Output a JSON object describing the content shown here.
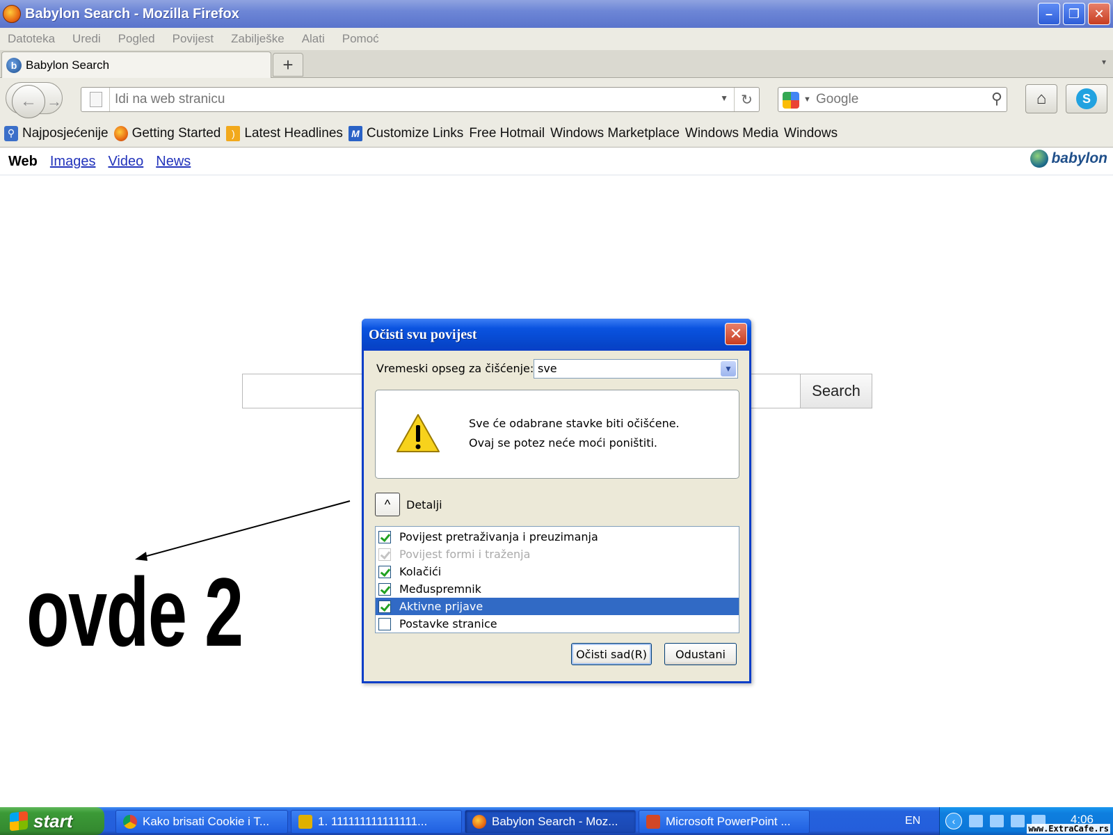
{
  "window": {
    "title": "Babylon Search - Mozilla Firefox",
    "minimize": "–",
    "maximize": "❐",
    "close": "✕"
  },
  "menu": [
    "Datoteka",
    "Uredi",
    "Pogled",
    "Povijest",
    "Zabilješke",
    "Alati",
    "Pomoć"
  ],
  "tab": {
    "label": "Babylon Search",
    "new_tab": "+",
    "list": "▾"
  },
  "nav": {
    "back": "←",
    "forward": "→",
    "url_placeholder": "Idi na web stranicu",
    "reload": "↻",
    "search_placeholder": "Google",
    "search_icon": "search-icon",
    "home": "⌂",
    "skype": "S"
  },
  "bookmarks": [
    {
      "label": "Najposjećenije",
      "icon": "most-visited-icon"
    },
    {
      "label": "Getting Started",
      "icon": "firefox-icon"
    },
    {
      "label": "Latest Headlines",
      "icon": "rss-icon"
    },
    {
      "label": "Customize Links",
      "icon": "msn-icon"
    },
    {
      "label": "Free Hotmail",
      "icon": "page-icon"
    },
    {
      "label": "Windows Marketplace",
      "icon": "page-icon"
    },
    {
      "label": "Windows Media",
      "icon": "page-icon"
    },
    {
      "label": "Windows",
      "icon": "page-icon"
    }
  ],
  "babylon": {
    "nav_active": "Web",
    "nav_links": [
      "Images",
      "Video",
      "News"
    ],
    "logo": "babylon",
    "search_button": "Search"
  },
  "annotation": {
    "text": "ovde 2"
  },
  "dialog": {
    "title": "Očisti svu povijest",
    "close": "✕",
    "range_label": "Vremeski opseg za čišćenje:",
    "range_value": "sve",
    "warning_line1": "Sve će odabrane stavke biti očišćene.",
    "warning_line2": "Ovaj se potez neće moći poništiti.",
    "details_toggle": "^",
    "details_label": "Detalji",
    "items": [
      {
        "label": "Povijest pretraživanja i preuzimanja",
        "checked": true,
        "disabled": false,
        "selected": false
      },
      {
        "label": "Povijest formi i traženja",
        "checked": true,
        "disabled": true,
        "selected": false
      },
      {
        "label": "Kolačići",
        "checked": true,
        "disabled": false,
        "selected": false
      },
      {
        "label": "Međuspremnik",
        "checked": true,
        "disabled": false,
        "selected": false
      },
      {
        "label": "Aktivne prijave",
        "checked": true,
        "disabled": false,
        "selected": true
      },
      {
        "label": "Postavke stranice",
        "checked": false,
        "disabled": false,
        "selected": false
      }
    ],
    "ok_button": "Očisti sad(R)",
    "cancel_button": "Odustani"
  },
  "taskbar": {
    "start": "start",
    "buttons": [
      {
        "label": "Kako brisati Cookie i T...",
        "icon": "chrome-icon",
        "active": false
      },
      {
        "label": "1. 111111111111111...",
        "icon": "app-icon",
        "active": false
      },
      {
        "label": "Babylon Search - Moz...",
        "icon": "firefox-icon",
        "active": true
      },
      {
        "label": "Microsoft PowerPoint ...",
        "icon": "powerpoint-icon",
        "active": false
      }
    ],
    "language": "EN",
    "tray_chevron": "‹",
    "clock": "4:06"
  },
  "watermark": "www.ExtraCafe.rs",
  "colors": {
    "xp_blue": "#0a3ec8",
    "selection": "#316ac5",
    "taskbar": "#245edb",
    "start_green": "#3c9a37",
    "link": "#2233bb"
  }
}
